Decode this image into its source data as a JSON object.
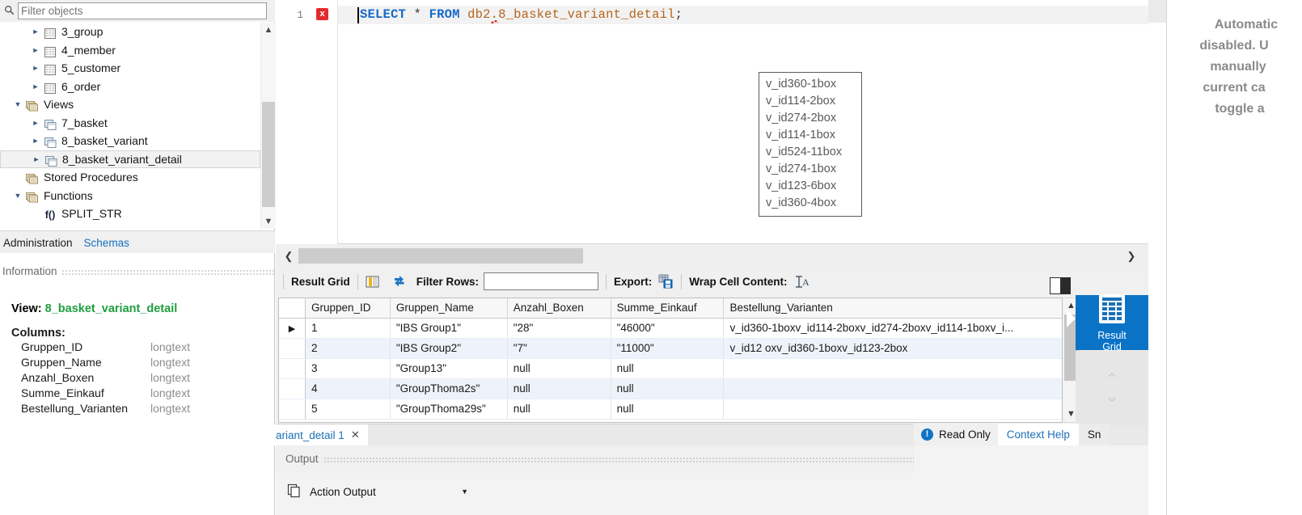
{
  "sidebar": {
    "filter": {
      "placeholder": "Filter objects",
      "value": "",
      "icon": "search-icon"
    },
    "tree": [
      {
        "label": "3_group",
        "icon": "table-icon",
        "indent": 2,
        "twisty": "collapsed",
        "selected": false
      },
      {
        "label": "4_member",
        "icon": "table-icon",
        "indent": 2,
        "twisty": "collapsed",
        "selected": false
      },
      {
        "label": "5_customer",
        "icon": "table-icon",
        "indent": 2,
        "twisty": "collapsed",
        "selected": false
      },
      {
        "label": "6_order",
        "icon": "table-icon",
        "indent": 2,
        "twisty": "collapsed",
        "selected": false
      },
      {
        "label": "Views",
        "icon": "folder-icon",
        "indent": 1,
        "twisty": "expanded",
        "selected": false
      },
      {
        "label": "7_basket",
        "icon": "view-icon",
        "indent": 2,
        "twisty": "collapsed",
        "selected": false
      },
      {
        "label": "8_basket_variant",
        "icon": "view-icon",
        "indent": 2,
        "twisty": "collapsed",
        "selected": false
      },
      {
        "label": "8_basket_variant_detail",
        "icon": "view-icon",
        "indent": 2,
        "twisty": "collapsed",
        "selected": true
      },
      {
        "label": "Stored Procedures",
        "icon": "folder-icon",
        "indent": 1,
        "twisty": "none",
        "selected": false
      },
      {
        "label": "Functions",
        "icon": "folder-icon",
        "indent": 1,
        "twisty": "expanded",
        "selected": false
      },
      {
        "label": "SPLIT_STR",
        "icon": "function-icon",
        "indent": 2,
        "twisty": "none",
        "selected": false
      }
    ],
    "tabs": [
      {
        "label": "Administration",
        "active": false
      },
      {
        "label": "Schemas",
        "active": true
      }
    ],
    "information": {
      "header": "Information",
      "view_label": "View:",
      "view_name": "8_basket_variant_detail",
      "columns_header": "Columns:",
      "columns": [
        {
          "name": "Gruppen_ID",
          "type": "longtext"
        },
        {
          "name": "Gruppen_Name",
          "type": "longtext"
        },
        {
          "name": "Anzahl_Boxen",
          "type": "longtext"
        },
        {
          "name": "Summe_Einkauf",
          "type": "longtext"
        },
        {
          "name": "Bestellung_Varianten",
          "type": "longtext"
        }
      ]
    }
  },
  "editor": {
    "line_number": "1",
    "error_marker": "x",
    "sql": {
      "keyword1": "SELECT",
      "star": "*",
      "keyword2": "FROM",
      "schema": "db2",
      "dot": ".",
      "object": "8_basket_variant_detail",
      "semicolon": ";"
    },
    "scroll_left_icon": "chevron-left-icon",
    "scroll_right_icon": "chevron-right-icon"
  },
  "result_toolbar": {
    "title": "Result Grid",
    "grid_view_icon": "grid-view-icon",
    "refresh_icon": "refresh-icon",
    "filter_rows_label": "Filter Rows:",
    "filter_rows_value": "",
    "export_label": "Export:",
    "export_icon": "export-icon",
    "wrap_cell_label": "Wrap Cell Content:",
    "wrap_cell_icon": "wrap-text-icon",
    "panel_toggle_icon": "toggle-sidebar-icon"
  },
  "grid": {
    "columns": [
      "Gruppen_ID",
      "Gruppen_Name",
      "Anzahl_Boxen",
      "Summe_Einkauf",
      "Bestellung_Varianten"
    ],
    "rows": [
      {
        "marker": "▶",
        "cells": [
          "1",
          "\"IBS Group1\"",
          "\"28\"",
          "\"46000\"",
          "v_id360-1boxv_id114-2boxv_id274-2boxv_id114-1boxv_i..."
        ]
      },
      {
        "marker": "",
        "cells": [
          "2",
          "\"IBS Group2\"",
          "\"7\"",
          "\"11000\"",
          "v_id12                       oxv_id360-1boxv_id123-2box"
        ]
      },
      {
        "marker": "",
        "cells": [
          "3",
          "\"Group13\"",
          "null",
          "null",
          ""
        ]
      },
      {
        "marker": "",
        "cells": [
          "4",
          "\"GroupThoma2s\"",
          "null",
          "null",
          ""
        ]
      },
      {
        "marker": "",
        "cells": [
          "5",
          "\"GroupThoma29s\"",
          "null",
          "null",
          ""
        ]
      }
    ]
  },
  "tooltip": {
    "lines": [
      "v_id360-1box",
      "v_id114-2box",
      "v_id274-2box",
      "v_id114-1box",
      "v_id524-11box",
      "v_id274-1box",
      "v_id123-6box",
      "v_id360-4box"
    ]
  },
  "result_tab": {
    "label": "ariant_detail 1",
    "close_icon": "close-icon"
  },
  "output": {
    "header": "Output",
    "copy_icon": "copy-icon",
    "selector_value": "Action Output",
    "selector_arrow": "chevron-down-icon"
  },
  "right_panel": {
    "result_grid_button": {
      "label_line1": "Result",
      "label_line2": "Grid",
      "icon": "result-grid-icon"
    },
    "pager": {
      "up_icon": "chevron-up-icon",
      "down_icon": "chevron-down-icon"
    },
    "context_help_text": "Automatic\ndisabled. U\nmanually\ncurrent ca\ntoggle a"
  },
  "status_bar": {
    "read_only": "Read Only",
    "info_icon": "info-icon",
    "tabs": [
      {
        "label": "Context Help",
        "active": true
      },
      {
        "label": "Sn",
        "active": false
      }
    ]
  },
  "colors": {
    "accent_blue": "#0a73c6",
    "link_blue": "#1d6fb8",
    "view_green": "#1e9e3e",
    "error_red": "#e02b2b",
    "identifier_orange": "#b5651d",
    "keyword_blue": "#1569c7"
  }
}
